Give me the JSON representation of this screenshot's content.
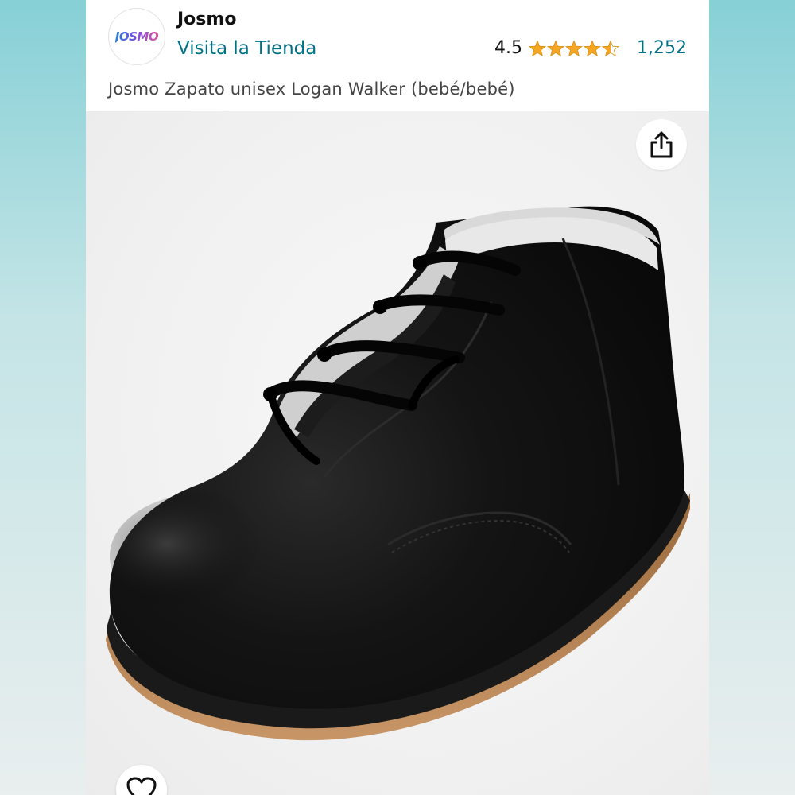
{
  "brand": {
    "logo_text": "JOSMO",
    "name": "Josmo",
    "store_link": "Visita la Tienda"
  },
  "rating": {
    "value": "4.5",
    "stars": 4.5,
    "count": "1,252"
  },
  "product": {
    "title": "Josmo Zapato unisex Logan Walker (bebé/bebé)"
  },
  "icons": {
    "share": "share-icon",
    "wishlist": "heart-icon"
  },
  "colors": {
    "link": "#007185",
    "star": "#f5a623",
    "backdrop_top": "#86d0d6"
  }
}
